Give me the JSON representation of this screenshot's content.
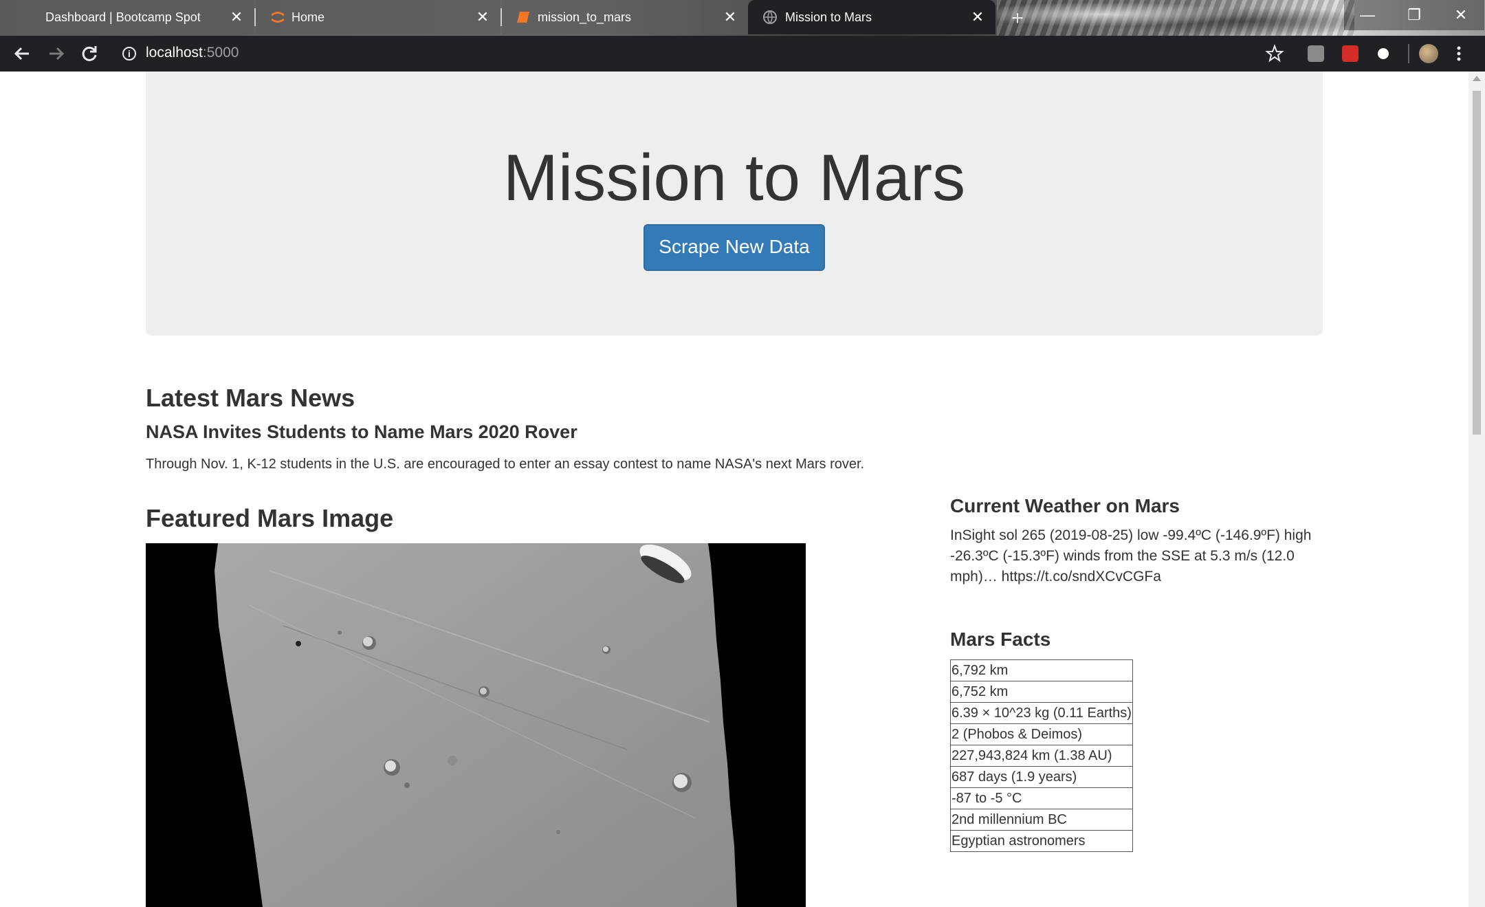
{
  "browser": {
    "tabs": [
      {
        "title": "Dashboard | Bootcamp Spot",
        "active": false
      },
      {
        "title": "Home",
        "active": false
      },
      {
        "title": "mission_to_mars",
        "active": false
      },
      {
        "title": "Mission to Mars",
        "active": true
      }
    ],
    "tab_close_glyph": "✕",
    "new_tab_glyph": "+",
    "window_controls": {
      "minimize": "—",
      "restore": "❐",
      "close": "✕"
    },
    "address": {
      "host": "localhost",
      "port": ":5000"
    }
  },
  "jumbotron": {
    "title": "Mission to Mars",
    "button_label": "Scrape New Data"
  },
  "news": {
    "heading": "Latest Mars News",
    "title": "NASA Invites Students to Name Mars 2020 Rover",
    "paragraph": "Through Nov. 1, K-12 students in the U.S. are encouraged to enter an essay contest to name NASA's next Mars rover."
  },
  "featured": {
    "heading": "Featured Mars Image"
  },
  "weather": {
    "heading": "Current Weather on Mars",
    "text": "InSight sol 265 (2019-08-25) low -99.4ºC (-146.9ºF) high -26.3ºC (-15.3ºF) winds from the SSE at 5.3 m/s (12.0 mph)… https://t.co/sndXCvCGFa"
  },
  "facts": {
    "heading": "Mars Facts",
    "rows": [
      "6,792 km",
      "6,752 km",
      "6.39 × 10^23 kg (0.11 Earths)",
      "2 (Phobos & Deimos)",
      "227,943,824 km (1.38 AU)",
      "687 days (1.9 years)",
      "-87 to -5 °C",
      "2nd millennium BC",
      "Egyptian astronomers"
    ]
  },
  "colors": {
    "button_primary": "#337ab7",
    "jumbotron_bg": "#eeeeee",
    "browser_chrome": "#202124"
  }
}
